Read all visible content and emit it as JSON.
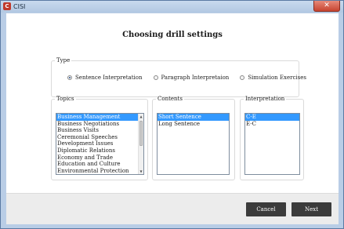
{
  "window": {
    "title": "CISI",
    "app_icon_glyph": "C",
    "close_glyph": "✕"
  },
  "heading": "Choosing drill settings",
  "type_group": {
    "legend": "Type",
    "options": [
      {
        "label": "Sentence Interpretation",
        "checked": true
      },
      {
        "label": "Paragraph Interpretaion",
        "checked": false
      },
      {
        "label": "Simulation Exercises",
        "checked": false
      }
    ]
  },
  "topics": {
    "legend": "Topics",
    "items": [
      "Business Management",
      "Business Negotiations",
      "Business Visits",
      "Ceremonial Speeches",
      "Development Issues",
      "Diplomatic Relations",
      "Economy and Trade",
      "Education and Culture",
      "Environmental Protection"
    ],
    "selected_index": 0
  },
  "contents": {
    "legend": "Contents",
    "items": [
      "Short Sentence",
      "Long Sentence"
    ],
    "selected_index": 0
  },
  "interpretation": {
    "legend": "Interpretation",
    "items": [
      "C-E",
      "E-C"
    ],
    "selected_index": 0
  },
  "footer": {
    "cancel_label": "Cancel",
    "next_label": "Next"
  },
  "icons": {
    "scroll_up": "▲",
    "scroll_down": "▼"
  }
}
